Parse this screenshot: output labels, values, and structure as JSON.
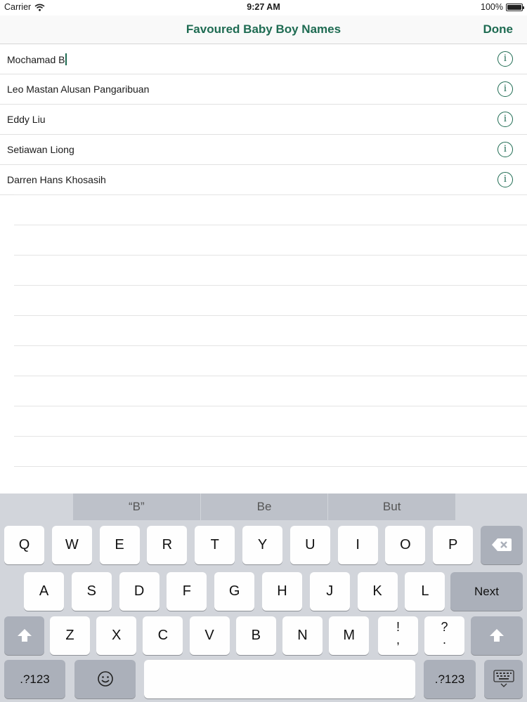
{
  "status_bar": {
    "carrier": "Carrier",
    "time": "9:27 AM",
    "battery": "100%",
    "battery_level": 1.0
  },
  "nav": {
    "title": "Favoured Baby Boy Names",
    "done": "Done"
  },
  "names": [
    "Mochamad B",
    "Leo Mastan Alusan Pangaribuan",
    "Eddy Liu",
    "Setiawan Liong",
    "Darren Hans Khosasih"
  ],
  "info_glyph": "i",
  "keyboard": {
    "suggestions": [
      "“B”",
      "Be",
      "But"
    ],
    "row1": [
      "Q",
      "W",
      "E",
      "R",
      "T",
      "Y",
      "U",
      "I",
      "O",
      "P"
    ],
    "row2": [
      "A",
      "S",
      "D",
      "F",
      "G",
      "H",
      "J",
      "K",
      "L"
    ],
    "row3": [
      "Z",
      "X",
      "C",
      "V",
      "B",
      "N",
      "M"
    ],
    "next": "Next",
    "num": ".?123",
    "punct1": [
      "!",
      ","
    ],
    "punct2": [
      "?",
      "."
    ],
    "icons": [
      "backspace-icon",
      "shift-icon",
      "emoji-icon",
      "hide-keyboard-icon"
    ]
  }
}
